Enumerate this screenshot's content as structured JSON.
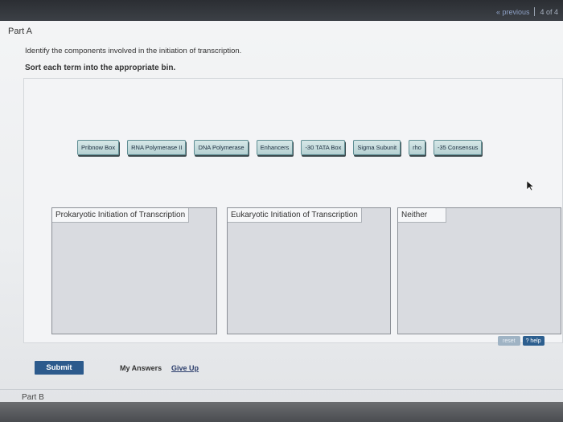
{
  "nav": {
    "previous": "« previous",
    "page": "4 of 4"
  },
  "part_a": "Part A",
  "instruction": "Identify the components involved in the initiation of transcription.",
  "sort_prompt": "Sort each term into the appropriate bin.",
  "tiles": [
    "Pribnow Box",
    "RNA Polymerase II",
    "DNA Polymerase",
    "Enhancers",
    "-30 TATA Box",
    "Sigma Subunit",
    "rho",
    "-35 Consensus"
  ],
  "bins": [
    "Prokaryotic Initiation of Transcription",
    "Eukaryotic Initiation of Transcription",
    "Neither"
  ],
  "controls": {
    "reset": "reset",
    "help": "? help"
  },
  "submit": "Submit",
  "my_answers": "My Answers",
  "give_up": "Give Up",
  "part_b": "Part B"
}
